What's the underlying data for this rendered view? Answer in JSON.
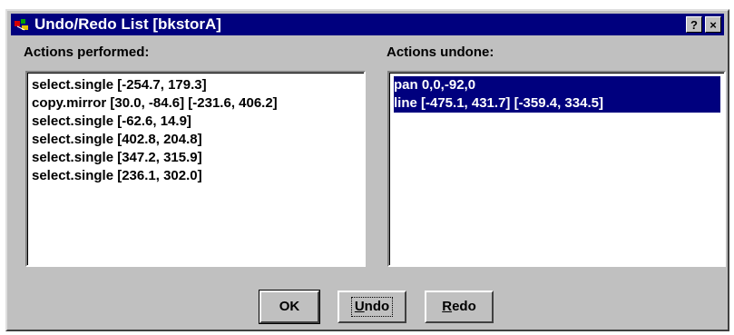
{
  "window": {
    "title": "Undo/Redo List [bkstorA]",
    "help_button": "?",
    "close_button": "×"
  },
  "performed": {
    "label": "Actions performed:",
    "items": [
      "select.single [-254.7, 179.3]",
      "copy.mirror [30.0, -84.6] [-231.6, 406.2]",
      "select.single [-62.6, 14.9]",
      "select.single [402.8, 204.8]",
      "select.single [347.2, 315.9]",
      "select.single [236.1, 302.0]"
    ]
  },
  "undone": {
    "label": "Actions undone:",
    "items": [
      "pan 0,0,-92,0",
      "line [-475.1, 431.7] [-359.4, 334.5]"
    ],
    "selected_items": [
      0,
      1
    ]
  },
  "buttons": {
    "ok": "OK",
    "undo_mnemonic": "U",
    "undo_rest": "ndo",
    "redo_mnemonic": "R",
    "redo_rest": "edo"
  },
  "colors": {
    "titlebar": "#00007e",
    "selection": "#00007e",
    "face": "#c0c0c0"
  }
}
